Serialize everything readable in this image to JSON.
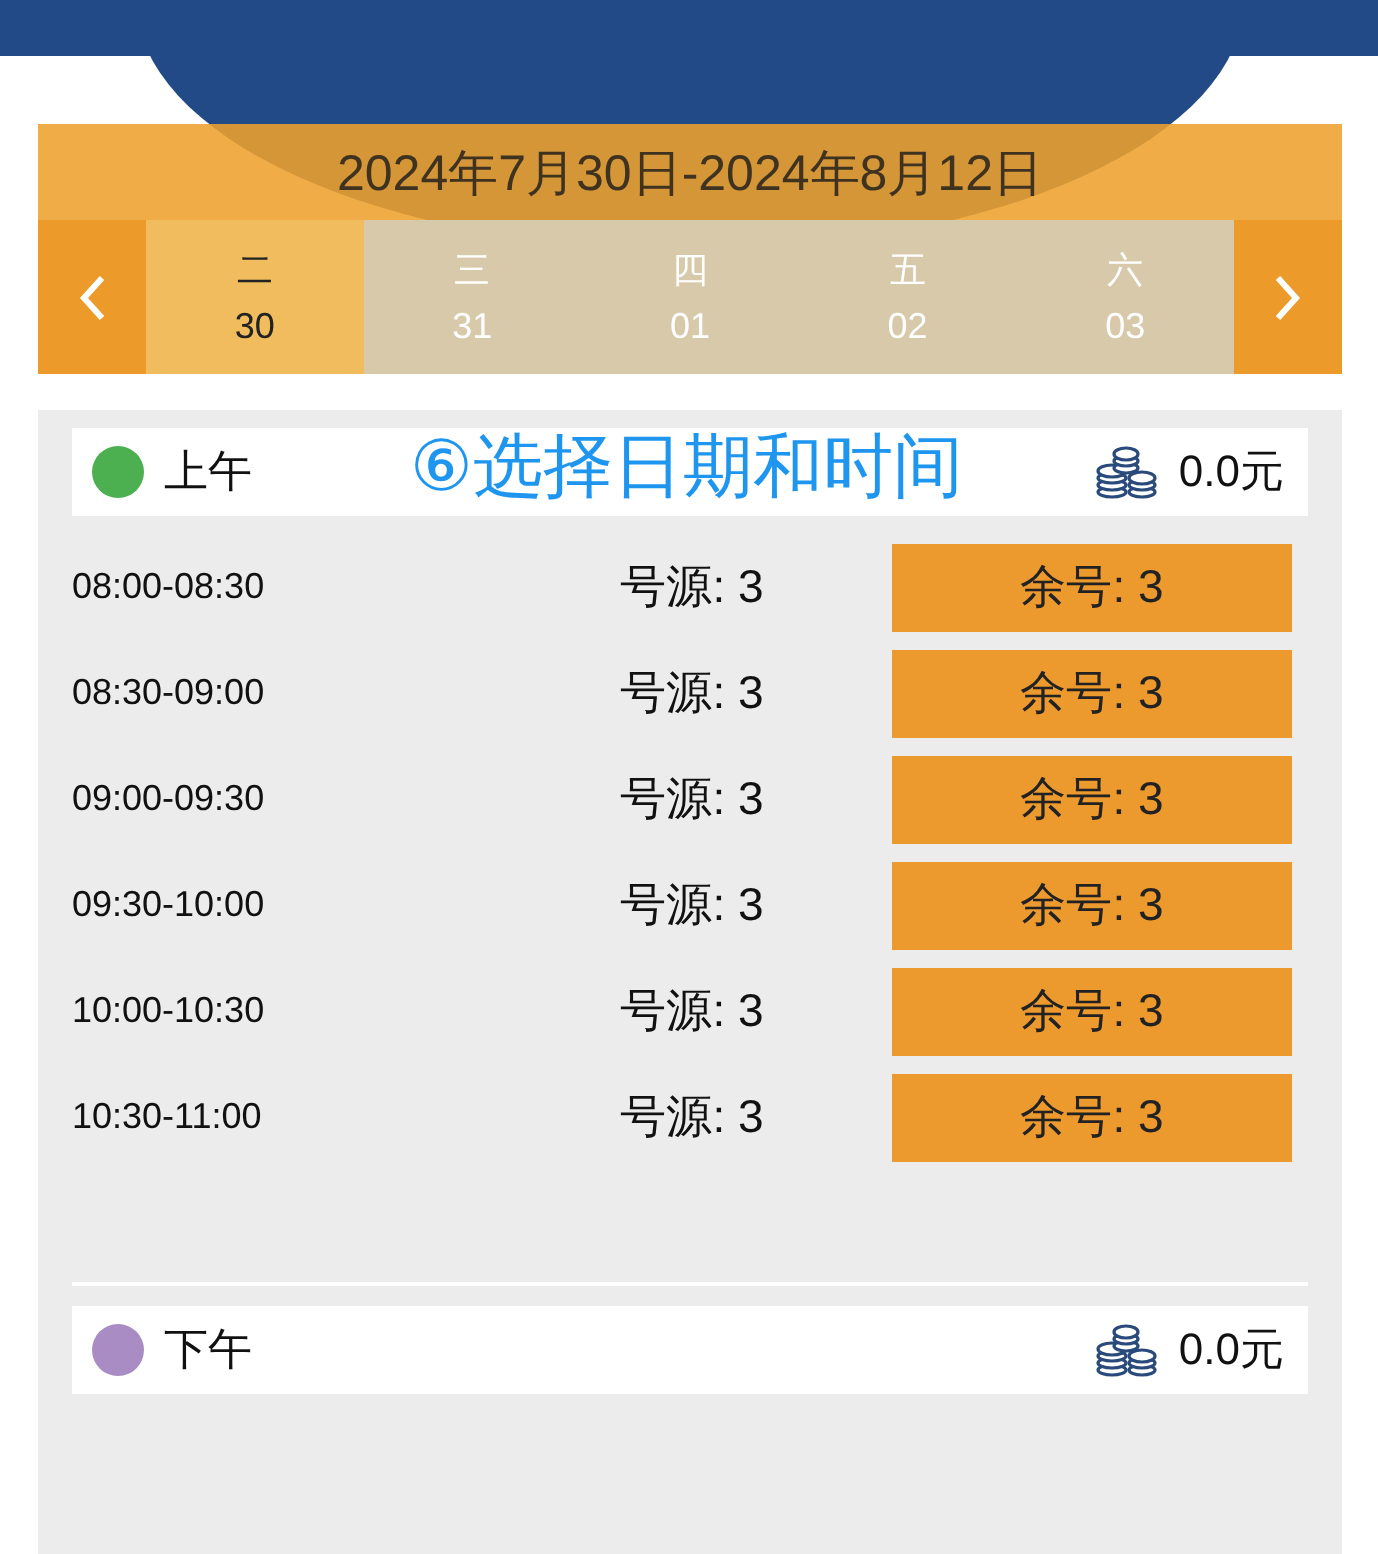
{
  "date_range": "2024年7月30日-2024年8月12日",
  "days": [
    {
      "weekday": "二",
      "date": "30",
      "selected": true
    },
    {
      "weekday": "三",
      "date": "31",
      "selected": false
    },
    {
      "weekday": "四",
      "date": "01",
      "selected": false
    },
    {
      "weekday": "五",
      "date": "02",
      "selected": false
    },
    {
      "weekday": "六",
      "date": "03",
      "selected": false
    }
  ],
  "annotation": "⑥选择日期和时间",
  "sessions": [
    {
      "label": "上午",
      "color": "#4caf50",
      "fee": "0.0元",
      "slots": [
        {
          "time": "08:00-08:30",
          "source": "号源: 3",
          "remaining": "余号: 3"
        },
        {
          "time": "08:30-09:00",
          "source": "号源: 3",
          "remaining": "余号: 3"
        },
        {
          "time": "09:00-09:30",
          "source": "号源: 3",
          "remaining": "余号: 3"
        },
        {
          "time": "09:30-10:00",
          "source": "号源: 3",
          "remaining": "余号: 3"
        },
        {
          "time": "10:00-10:30",
          "source": "号源: 3",
          "remaining": "余号: 3"
        },
        {
          "time": "10:30-11:00",
          "source": "号源: 3",
          "remaining": "余号: 3"
        }
      ]
    },
    {
      "label": "下午",
      "color": "#a98cc3",
      "fee": "0.0元"
    }
  ]
}
